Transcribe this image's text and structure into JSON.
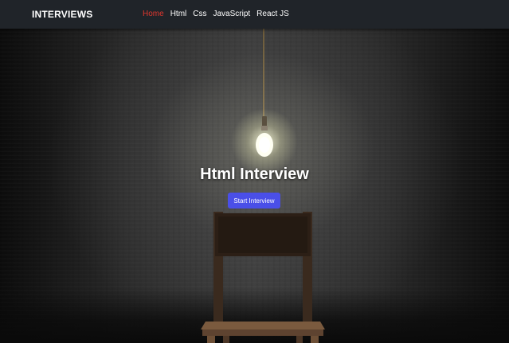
{
  "navbar": {
    "brand": "INTERVIEWS",
    "links": [
      {
        "label": "Home",
        "active": true
      },
      {
        "label": "Html",
        "active": false
      },
      {
        "label": "Css",
        "active": false
      },
      {
        "label": "JavaScript",
        "active": false
      },
      {
        "label": "React JS",
        "active": false
      }
    ]
  },
  "hero": {
    "title": "Html Interview",
    "button_label": "Start Interview"
  },
  "colors": {
    "navbar_bg": "#202429",
    "active_link": "#e0372e",
    "button_bg": "#4a4fe8",
    "text": "#ffffff"
  },
  "icons": {
    "background": "light-bulb-and-chair-illustration"
  }
}
